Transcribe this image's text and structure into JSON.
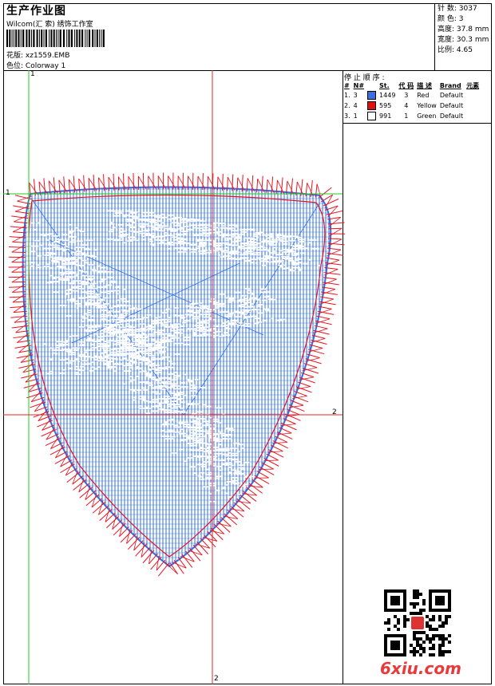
{
  "header": {
    "title": "生产作业图",
    "subtitle": "Wilcom(汇 索) 绣饰工作室",
    "design_label": "花版:",
    "design_value": "xz1559.EMB",
    "colorway_label": "色位:",
    "colorway_value": "Colorway 1"
  },
  "stats": {
    "stitches_label": "针 数:",
    "stitches_value": "3037",
    "colors_label": "颜 色:",
    "colors_value": "3",
    "height_label": "高度:",
    "height_value": "37.8 mm",
    "width_label": "宽度:",
    "width_value": "30.3 mm",
    "ratio_label": "比例:",
    "ratio_value": "4.65"
  },
  "stop_sequence": {
    "title": "停 止 顺 序 :",
    "headers": [
      "#",
      "N#",
      "St.",
      "代 码",
      "描 述",
      "Brand",
      "元素"
    ],
    "rows": [
      {
        "index": "1.",
        "needle": "3",
        "color": "#3b6fe0",
        "stitches": "1449",
        "code": "3",
        "description": "Red",
        "brand": "Default"
      },
      {
        "index": "2.",
        "needle": "4",
        "color": "#e01010",
        "stitches": "595",
        "code": "4",
        "description": "Yellow",
        "brand": "Default"
      },
      {
        "index": "3.",
        "needle": "1",
        "color": "#ffffff",
        "stitches": "991",
        "code": "1",
        "description": "Green",
        "brand": "Default"
      }
    ]
  },
  "axis_labels": {
    "top": "1",
    "left": "1",
    "right": "2",
    "bottom": "2"
  },
  "colors": {
    "fill_stitch": "#2f6fe8",
    "border_stitch": "#e8121e",
    "guide_red": "#e82020",
    "guide_green": "#22cc22"
  },
  "watermark": "6xiu.com"
}
